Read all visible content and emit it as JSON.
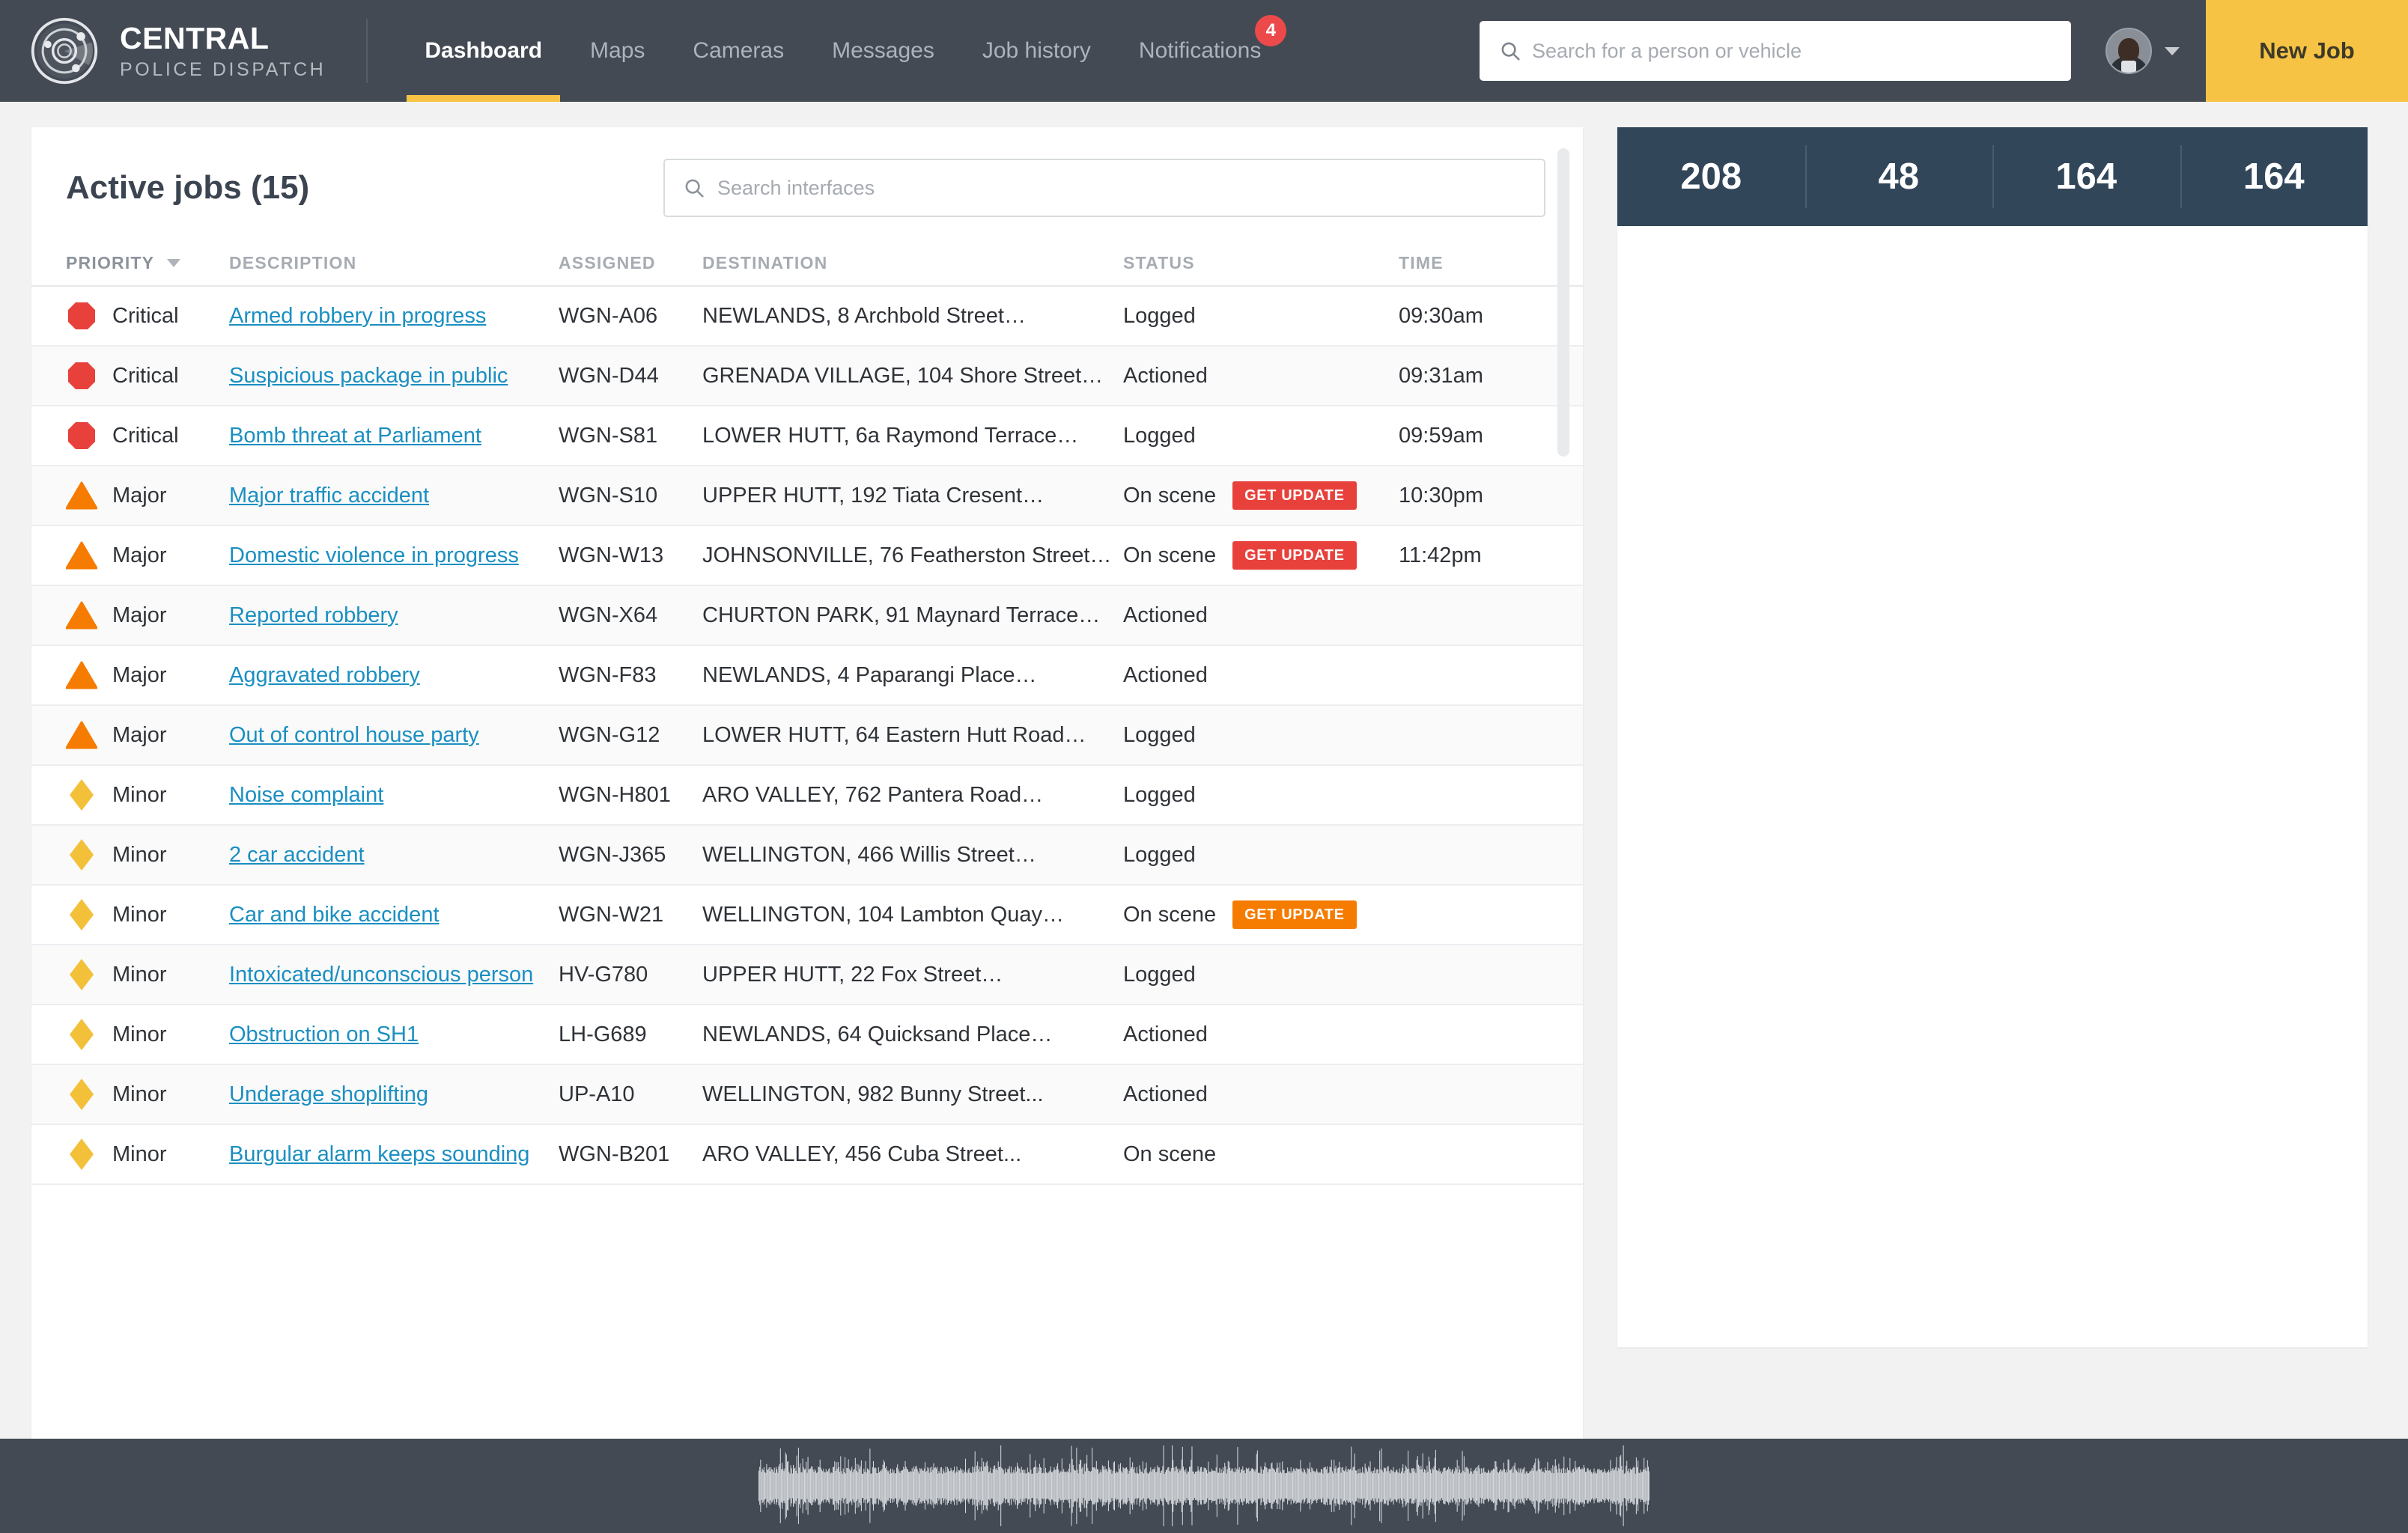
{
  "brand": {
    "line1": "CENTRAL",
    "line2": "POLICE DISPATCH",
    "logo_icon": "radar-target-icon"
  },
  "nav": {
    "items": [
      {
        "label": "Dashboard",
        "active": true
      },
      {
        "label": "Maps",
        "active": false
      },
      {
        "label": "Cameras",
        "active": false
      },
      {
        "label": "Messages",
        "active": false
      },
      {
        "label": "Job history",
        "active": false
      },
      {
        "label": "Notifications",
        "active": false,
        "badge": "4"
      }
    ]
  },
  "global_search": {
    "placeholder": "Search for a person or vehicle",
    "value": "",
    "icon": "search-icon"
  },
  "account": {
    "avatar_icon": "user-avatar",
    "caret_icon": "chevron-down-icon"
  },
  "new_job_button": {
    "label": "New Job"
  },
  "jobs": {
    "title": "Active jobs (15)",
    "search": {
      "placeholder": "Search interfaces",
      "value": "",
      "icon": "search-icon"
    },
    "columns": [
      "PRIORITY",
      "DESCRIPTION",
      "ASSIGNED",
      "DESTINATION",
      "STATUS",
      "TIME"
    ],
    "sorted_column": "PRIORITY",
    "sort_caret_icon": "caret-down-icon",
    "rows": [
      {
        "priority": "Critical",
        "icon": "octagon-icon",
        "color": "#e8413c",
        "description": "Armed robbery in progress",
        "assigned": "WGN-A06",
        "destination": "NEWLANDS, 8 Archbold Street…",
        "status": "Logged",
        "badge": "",
        "badge_color": "",
        "time": "09:30am"
      },
      {
        "priority": "Critical",
        "icon": "octagon-icon",
        "color": "#e8413c",
        "description": "Suspicious package in public",
        "assigned": "WGN-D44",
        "destination": "GRENADA VILLAGE, 104 Shore Street…",
        "status": "Actioned",
        "badge": "",
        "badge_color": "",
        "time": "09:31am"
      },
      {
        "priority": "Critical",
        "icon": "octagon-icon",
        "color": "#e8413c",
        "description": "Bomb threat at Parliament",
        "assigned": "WGN-S81",
        "destination": "LOWER HUTT, 6a Raymond Terrace…",
        "status": "Logged",
        "badge": "",
        "badge_color": "",
        "time": "09:59am"
      },
      {
        "priority": "Major",
        "icon": "triangle-icon",
        "color": "#f57c00",
        "description": "Major traffic accident",
        "assigned": "WGN-S10",
        "destination": "UPPER HUTT, 192 Tiata Cresent…",
        "status": "On scene",
        "badge": "GET UPDATE",
        "badge_color": "red",
        "time": "10:30pm"
      },
      {
        "priority": "Major",
        "icon": "triangle-icon",
        "color": "#f57c00",
        "description": "Domestic violence in progress",
        "assigned": "WGN-W13",
        "destination": "JOHNSONVILLE, 76 Featherston Street…",
        "status": "On scene",
        "badge": "GET UPDATE",
        "badge_color": "red",
        "time": "11:42pm"
      },
      {
        "priority": "Major",
        "icon": "triangle-icon",
        "color": "#f57c00",
        "description": "Reported robbery",
        "assigned": "WGN-X64",
        "destination": "CHURTON PARK, 91 Maynard Terrace…",
        "status": "Actioned",
        "badge": "",
        "badge_color": "",
        "time": ""
      },
      {
        "priority": "Major",
        "icon": "triangle-icon",
        "color": "#f57c00",
        "description": "Aggravated robbery",
        "assigned": "WGN-F83",
        "destination": "NEWLANDS, 4 Paparangi Place…",
        "status": "Actioned",
        "badge": "",
        "badge_color": "",
        "time": ""
      },
      {
        "priority": "Major",
        "icon": "triangle-icon",
        "color": "#f57c00",
        "description": "Out of control house party",
        "assigned": "WGN-G12",
        "destination": "LOWER HUTT, 64 Eastern Hutt Road…",
        "status": "Logged",
        "badge": "",
        "badge_color": "",
        "time": ""
      },
      {
        "priority": "Minor",
        "icon": "diamond-icon",
        "color": "#f3c03a",
        "description": "Noise complaint",
        "assigned": "WGN-H801",
        "destination": "ARO VALLEY, 762 Pantera Road…",
        "status": "Logged",
        "badge": "",
        "badge_color": "",
        "time": ""
      },
      {
        "priority": "Minor",
        "icon": "diamond-icon",
        "color": "#f3c03a",
        "description": "2 car accident",
        "assigned": "WGN-J365",
        "destination": "WELLINGTON, 466 Willis Street…",
        "status": "Logged",
        "badge": "",
        "badge_color": "",
        "time": ""
      },
      {
        "priority": "Minor",
        "icon": "diamond-icon",
        "color": "#f3c03a",
        "description": "Car and bike accident",
        "assigned": "WGN-W21",
        "destination": "WELLINGTON, 104 Lambton Quay…",
        "status": "On scene",
        "badge": "GET UPDATE",
        "badge_color": "orange",
        "time": ""
      },
      {
        "priority": "Minor",
        "icon": "diamond-icon",
        "color": "#f3c03a",
        "description": "Intoxicated/unconscious person",
        "assigned": "HV-G780",
        "destination": "UPPER HUTT, 22 Fox Street…",
        "status": "Logged",
        "badge": "",
        "badge_color": "",
        "time": ""
      },
      {
        "priority": "Minor",
        "icon": "diamond-icon",
        "color": "#f3c03a",
        "description": "Obstruction on SH1",
        "assigned": "LH-G689",
        "destination": "NEWLANDS, 64 Quicksand Place…",
        "status": "Actioned",
        "badge": "",
        "badge_color": "",
        "time": ""
      },
      {
        "priority": "Minor",
        "icon": "diamond-icon",
        "color": "#f3c03a",
        "description": "Underage shoplifting",
        "assigned": "UP-A10",
        "destination": "WELLINGTON, 982 Bunny Street...",
        "status": "Actioned",
        "badge": "",
        "badge_color": "",
        "time": ""
      },
      {
        "priority": "Minor",
        "icon": "diamond-icon",
        "color": "#f3c03a",
        "description": "Burgular alarm keeps sounding",
        "assigned": "WGN-B201",
        "destination": "ARO VALLEY, 456 Cuba Street...",
        "status": "On scene",
        "badge": "",
        "badge_color": "",
        "time": ""
      }
    ]
  },
  "stats": {
    "values": [
      "208",
      "48",
      "164",
      "164"
    ]
  },
  "footer": {
    "waveform_icon": "audio-waveform"
  },
  "colors": {
    "header_bg": "#434a54",
    "accent_yellow": "#f6c344",
    "link_blue": "#1a8fc1",
    "critical_red": "#e8413c",
    "major_orange": "#f57c00",
    "minor_yellow": "#f3c03a",
    "stats_navy": "#32465a",
    "page_bg": "#f2f2f2"
  }
}
